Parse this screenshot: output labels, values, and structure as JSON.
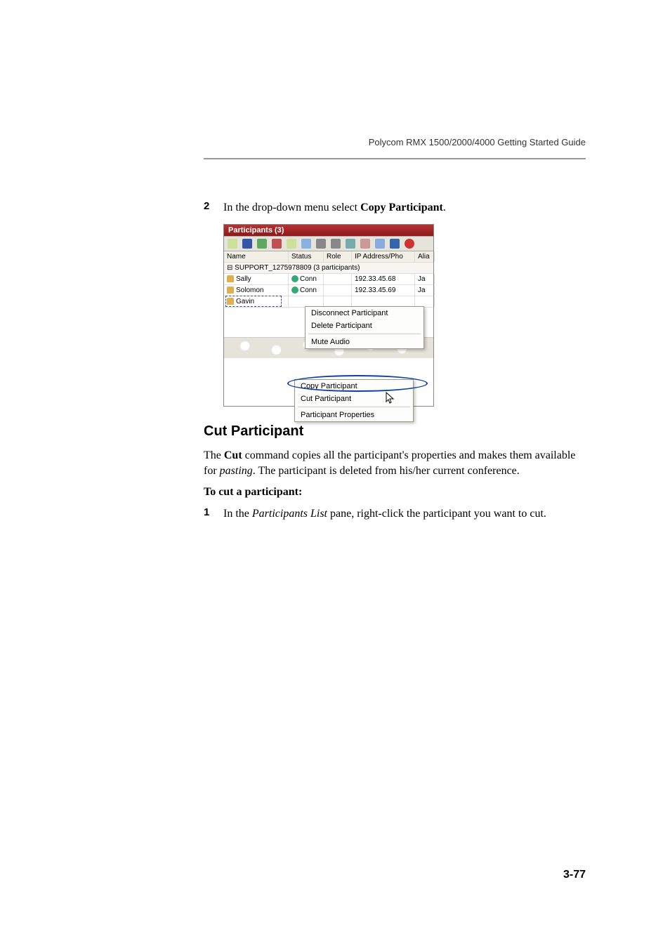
{
  "running_header": "Polycom RMX 1500/2000/4000 Getting Started Guide",
  "step2": {
    "num": "2",
    "text_pre": "In the drop-down menu select ",
    "bold": "Copy Participant",
    "text_post": "."
  },
  "shot": {
    "title": "Participants (3)",
    "headers": {
      "name": "Name",
      "status": "Status",
      "role": "Role",
      "ip": "IP Address/Pho",
      "alias": "Alia"
    },
    "group": "SUPPORT_1275978809 (3  participants)",
    "rows": [
      {
        "name": "Sally",
        "status": "Conn",
        "role": "",
        "ip": "192.33.45.68",
        "alias": "Ja"
      },
      {
        "name": "Solomon",
        "status": "Conn",
        "role": "",
        "ip": "192.33.45.69",
        "alias": "Ja"
      },
      {
        "name": "Gavin",
        "status": "",
        "role": "",
        "ip": "",
        "alias": ""
      }
    ],
    "menu1": {
      "disconnect": "Disconnect Participant",
      "delete": "Delete Participant",
      "mute": "Mute Audio"
    },
    "menu2": {
      "copy": "Copy Participant",
      "cut": "Cut Participant",
      "props": "Participant Properties"
    }
  },
  "section_heading": "Cut Participant",
  "para1": {
    "pre": "The ",
    "bold": "Cut",
    "mid": " command copies all the participant's properties and makes them available for ",
    "italic": "pasting",
    "post": ". The participant is deleted from his/her current conference."
  },
  "para2": "To cut a participant:",
  "step1": {
    "num": "1",
    "pre": "In the ",
    "italic": "Participants List",
    "post": " pane, right-click the participant you want to cut."
  },
  "page_number": "3-77"
}
